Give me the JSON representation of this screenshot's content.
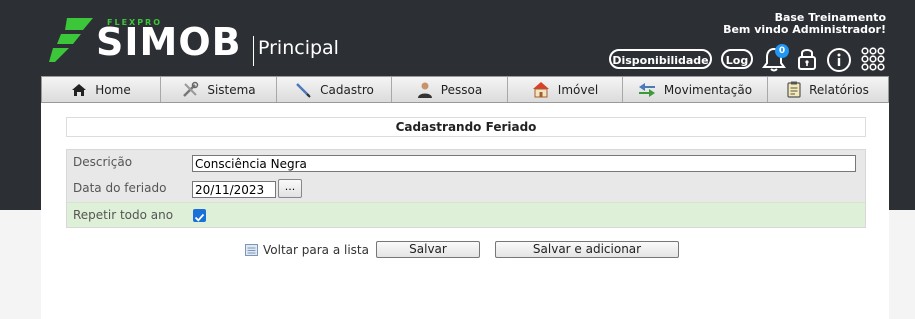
{
  "header": {
    "brand_small": "FLEXPRO",
    "brand": "SIMOB",
    "module": "Principal",
    "base_name": "Base Treinamento",
    "welcome": "Bem vindo Administrador!",
    "buttons": {
      "availability": "Disponibilidade",
      "log": "Log"
    },
    "notification_count": "0"
  },
  "menu": [
    {
      "label": "Home",
      "icon": "home-icon"
    },
    {
      "label": "Sistema",
      "icon": "tools-icon"
    },
    {
      "label": "Cadastro",
      "icon": "pen-icon"
    },
    {
      "label": "Pessoa",
      "icon": "person-icon"
    },
    {
      "label": "Imóvel",
      "icon": "house-icon"
    },
    {
      "label": "Movimentação",
      "icon": "arrows-icon"
    },
    {
      "label": "Relatórios",
      "icon": "clipboard-icon"
    }
  ],
  "form": {
    "title": "Cadastrando Feriado",
    "description_label": "Descrição",
    "description_value": "Consciência Negra",
    "date_label": "Data do feriado",
    "date_value": "20/11/2023",
    "date_button": "...",
    "repeat_label": "Repetir todo ano",
    "repeat_checked": true
  },
  "actions": {
    "back": "Voltar para a lista",
    "save": "Salvar",
    "save_add": "Salvar e adicionar"
  },
  "colors": {
    "header_bg": "#2c2f33",
    "brand_green": "#3cc63a",
    "checkbox": "#1a6fd8",
    "repeat_row": "#dff0d8"
  }
}
